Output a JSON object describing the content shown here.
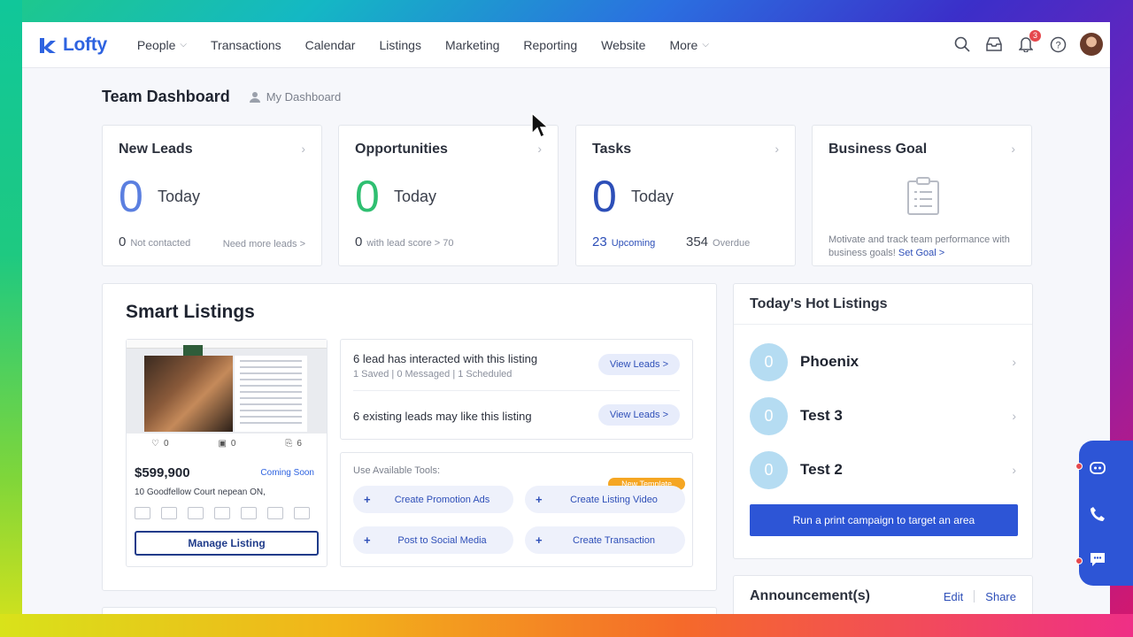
{
  "nav": {
    "brand": "Lofty",
    "items": [
      {
        "label": "People",
        "dropdown": true
      },
      {
        "label": "Transactions",
        "dropdown": false
      },
      {
        "label": "Calendar",
        "dropdown": false
      },
      {
        "label": "Listings",
        "dropdown": false
      },
      {
        "label": "Marketing",
        "dropdown": false
      },
      {
        "label": "Reporting",
        "dropdown": false
      },
      {
        "label": "Website",
        "dropdown": false
      },
      {
        "label": "More",
        "dropdown": true
      }
    ],
    "notification_count": "3"
  },
  "header": {
    "title": "Team Dashboard",
    "my_dashboard": "My Dashboard"
  },
  "cards": {
    "new_leads": {
      "title": "New Leads",
      "value": "0",
      "period": "Today",
      "foot_num": "0",
      "foot_label": "Not contacted",
      "link": "Need more leads >"
    },
    "opportunities": {
      "title": "Opportunities",
      "value": "0",
      "period": "Today",
      "foot_num": "0",
      "foot_label": "with lead score > 70"
    },
    "tasks": {
      "title": "Tasks",
      "value": "0",
      "period": "Today",
      "upcoming_num": "23",
      "upcoming_label": "Upcoming",
      "overdue_num": "354",
      "overdue_label": "Overdue"
    },
    "business_goal": {
      "title": "Business Goal",
      "desc": "Motivate and track team performance with business goals!",
      "link": "Set Goal >"
    }
  },
  "smart_listings": {
    "title": "Smart Listings",
    "listing": {
      "likes": "0",
      "saves": "0",
      "views": "6",
      "price": "$599,900",
      "status": "Coming Soon",
      "address": "10 Goodfellow Court nepean ON,",
      "manage_label": "Manage Listing"
    },
    "insights": [
      {
        "main": "6 lead has interacted with this listing",
        "sub": "1 Saved | 0 Messaged | 1 Scheduled",
        "button": "View Leads >"
      },
      {
        "main": "6 existing leads may like this listing",
        "sub": "",
        "button": "View Leads >"
      }
    ],
    "tools_label": "Use Available Tools:",
    "tools": [
      "Create Promotion Ads",
      "Create Listing Video",
      "Post to Social Media",
      "Create Transaction"
    ],
    "new_template_badge": "New Template"
  },
  "hot_listings": {
    "title": "Today's Hot Listings",
    "items": [
      {
        "count": "0",
        "name": "Phoenix"
      },
      {
        "count": "0",
        "name": "Test 3"
      },
      {
        "count": "0",
        "name": "Test 2"
      }
    ],
    "cta": "Run a print campaign to target an area"
  },
  "announcements": {
    "title": "Announcement(s)",
    "edit": "Edit",
    "share": "Share"
  },
  "colors": {
    "brand": "#2e63e0",
    "green": "#2fbf71",
    "primary_button": "#2d55d6"
  }
}
